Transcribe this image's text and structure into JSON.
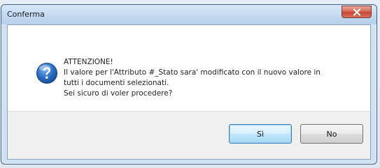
{
  "dialog": {
    "title": "Conferma",
    "message": {
      "heading": "ATTENZIONE!",
      "line1": "Il valore per l'Attributo #_Stato sara' modificato con il nuovo valore in",
      "line2": "tutti i documenti selezionati.",
      "line3": "Sei sicuro di voler procedere?"
    },
    "buttons": {
      "yes_label": "Sì",
      "no_label": "No"
    },
    "icons": {
      "message_icon": "question-icon",
      "close_icon": "close-icon"
    }
  }
}
